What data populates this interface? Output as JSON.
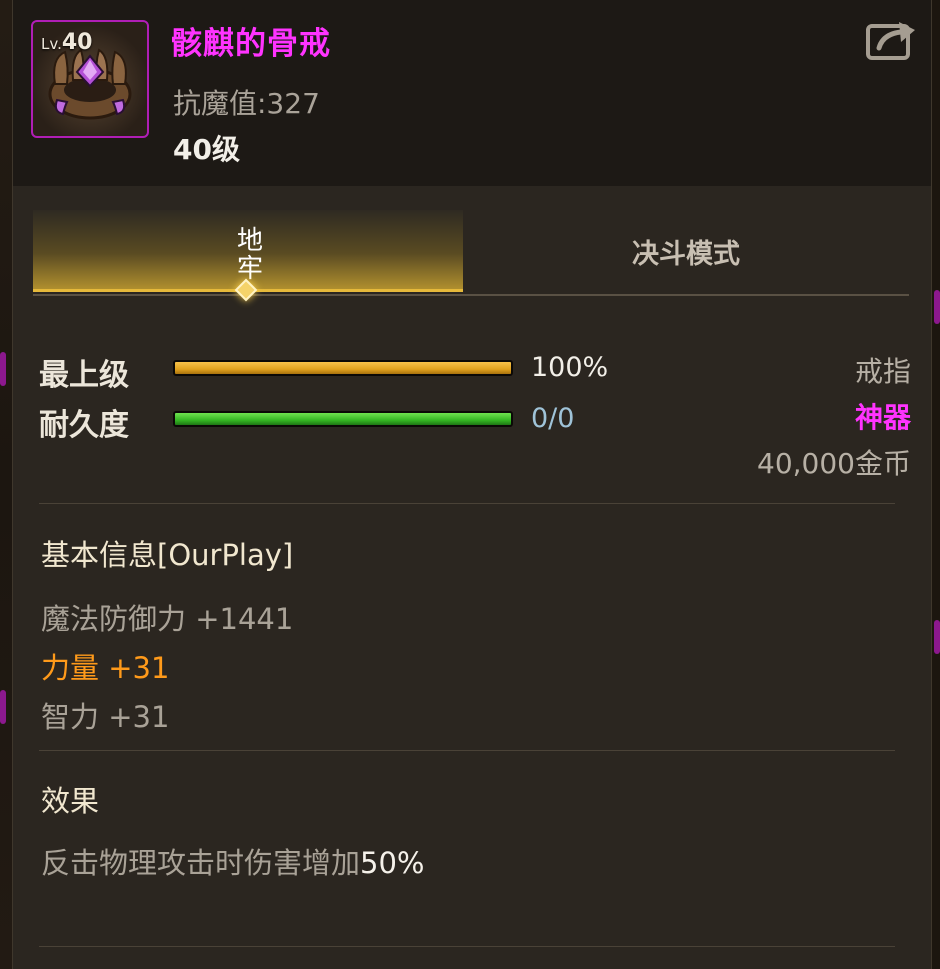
{
  "item": {
    "level_badge_prefix": "Lv.",
    "level_badge_value": "40",
    "name": "骸麒的骨戒",
    "resist_text": "抗魔值:327",
    "level_text": "40级",
    "rarity_color": "#ff33ff",
    "icon": "bone-ring-icon"
  },
  "share_button": {
    "icon": "share-icon"
  },
  "tabs": [
    {
      "label": "地牢",
      "active": true
    },
    {
      "label": "决斗模式",
      "active": false
    }
  ],
  "stats": {
    "top_grade": {
      "label": "最上级",
      "value": "100%",
      "fill": 1.0
    },
    "durability": {
      "label": "耐久度",
      "value": "0/0",
      "fill": 1.0
    }
  },
  "right_info": {
    "slot": "戒指",
    "rarity": "神器",
    "price": "40,000金币"
  },
  "basic_info": {
    "title": "基本信息[OurPlay]",
    "attributes": [
      {
        "text": "魔法防御力 +1441",
        "highlight": false
      },
      {
        "text": "力量 +31",
        "highlight": true
      },
      {
        "text": "智力 +31",
        "highlight": false
      }
    ]
  },
  "effect": {
    "title": "效果",
    "text_prefix": "反击物理攻击时伤害增加",
    "text_value": "50%"
  },
  "colors": {
    "accent_gold": "#e6b93b",
    "highlight_orange": "#ff9a1a",
    "rarity_magenta": "#ff33ff",
    "durability_value": "#9fc3d8"
  }
}
